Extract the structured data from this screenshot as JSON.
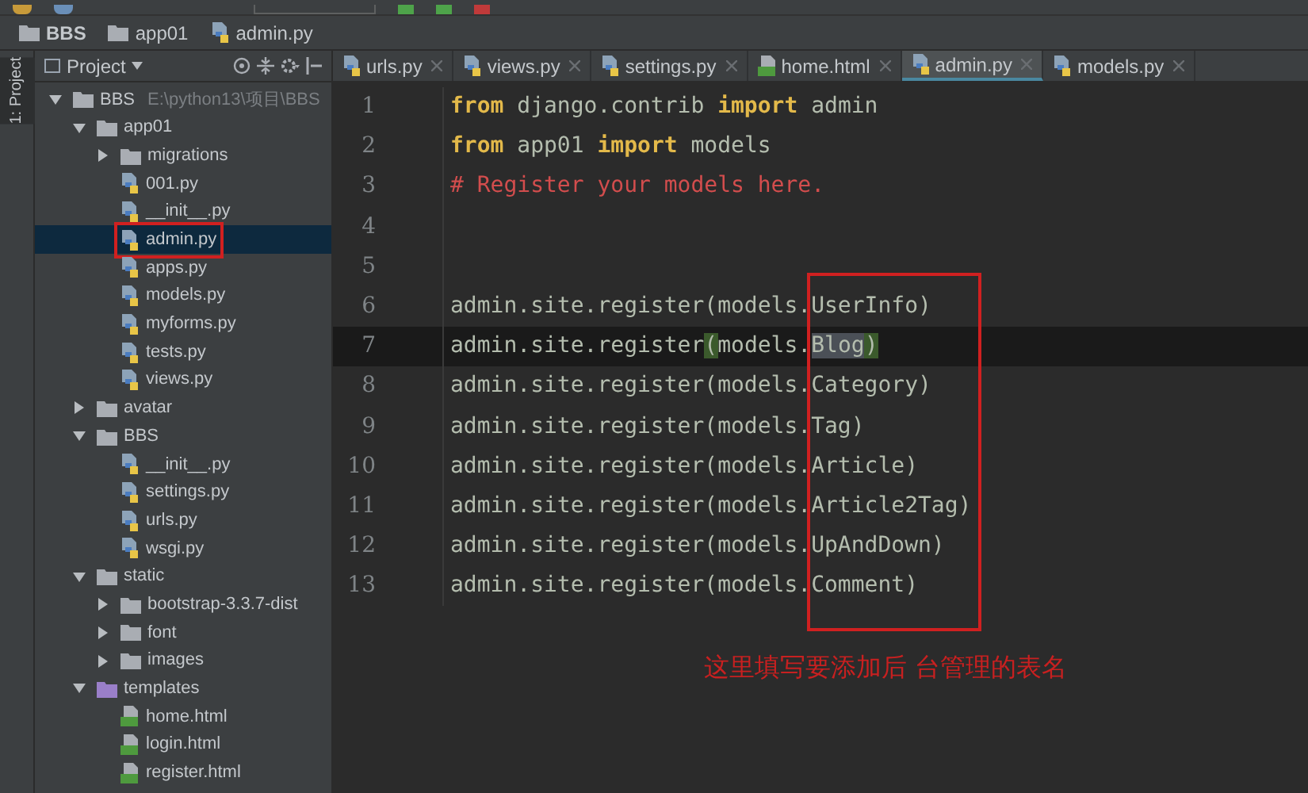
{
  "breadcrumb": [
    {
      "label": "BBS",
      "kind": "folder"
    },
    {
      "label": "app01",
      "kind": "folder"
    },
    {
      "label": "admin.py",
      "kind": "python"
    }
  ],
  "tool_window": {
    "side_label": "1: Project",
    "title": "Project"
  },
  "tree": [
    {
      "label": "BBS",
      "path": "E:\\python13\\项目\\BBS",
      "kind": "folder",
      "expanded": true,
      "selected": false,
      "children": [
        {
          "label": "app01",
          "kind": "folder",
          "expanded": true,
          "selected": false,
          "children": [
            {
              "label": "migrations",
              "kind": "folder",
              "expanded": false,
              "selected": false
            },
            {
              "label": "001.py",
              "kind": "python",
              "selected": false
            },
            {
              "label": "__init__.py",
              "kind": "python",
              "selected": false
            },
            {
              "label": "admin.py",
              "kind": "python",
              "selected": true,
              "boxed": true
            },
            {
              "label": "apps.py",
              "kind": "python",
              "selected": false
            },
            {
              "label": "models.py",
              "kind": "python",
              "selected": false
            },
            {
              "label": "myforms.py",
              "kind": "python",
              "selected": false
            },
            {
              "label": "tests.py",
              "kind": "python",
              "selected": false
            },
            {
              "label": "views.py",
              "kind": "python",
              "selected": false
            }
          ]
        },
        {
          "label": "avatar",
          "kind": "folder",
          "expanded": false,
          "selected": false
        },
        {
          "label": "BBS",
          "kind": "folder",
          "expanded": true,
          "selected": false,
          "children": [
            {
              "label": "__init__.py",
              "kind": "python",
              "selected": false
            },
            {
              "label": "settings.py",
              "kind": "python",
              "selected": false
            },
            {
              "label": "urls.py",
              "kind": "python",
              "selected": false
            },
            {
              "label": "wsgi.py",
              "kind": "python",
              "selected": false
            }
          ]
        },
        {
          "label": "static",
          "kind": "folder",
          "expanded": true,
          "selected": false,
          "children": [
            {
              "label": "bootstrap-3.3.7-dist",
              "kind": "folder",
              "expanded": false,
              "selected": false
            },
            {
              "label": "font",
              "kind": "folder",
              "expanded": false,
              "selected": false
            },
            {
              "label": "images",
              "kind": "folder",
              "expanded": false,
              "selected": false
            }
          ]
        },
        {
          "label": "templates",
          "kind": "template-folder",
          "expanded": true,
          "selected": false,
          "children": [
            {
              "label": "home.html",
              "kind": "html",
              "selected": false
            },
            {
              "label": "login.html",
              "kind": "html",
              "selected": false
            },
            {
              "label": "register.html",
              "kind": "html",
              "selected": false
            }
          ]
        }
      ]
    }
  ],
  "tabs": [
    {
      "label": "urls.py",
      "kind": "python",
      "selected": false
    },
    {
      "label": "views.py",
      "kind": "python",
      "selected": false
    },
    {
      "label": "settings.py",
      "kind": "python",
      "selected": false
    },
    {
      "label": "home.html",
      "kind": "html",
      "selected": false
    },
    {
      "label": "admin.py",
      "kind": "python",
      "selected": true
    },
    {
      "label": "models.py",
      "kind": "python",
      "selected": false
    }
  ],
  "code_lines": [
    {
      "number": "1",
      "current": false,
      "tokens": [
        {
          "kind": "keyword",
          "text": "from"
        },
        {
          "kind": "plain",
          "text": " django.contrib "
        },
        {
          "kind": "keyword",
          "text": "import"
        },
        {
          "kind": "plain",
          "text": " admin"
        }
      ]
    },
    {
      "number": "2",
      "current": false,
      "tokens": [
        {
          "kind": "keyword",
          "text": "from"
        },
        {
          "kind": "plain",
          "text": " app01 "
        },
        {
          "kind": "keyword",
          "text": "import"
        },
        {
          "kind": "plain",
          "text": " models"
        }
      ]
    },
    {
      "number": "3",
      "current": false,
      "tokens": [
        {
          "kind": "comment",
          "text": "# Register your models here."
        }
      ]
    },
    {
      "number": "4",
      "current": false
    },
    {
      "number": "5",
      "current": false
    },
    {
      "number": "6",
      "current": false,
      "tokens": [
        {
          "kind": "plain",
          "text": "admin.site.register(models.UserInfo)"
        }
      ]
    },
    {
      "number": "7",
      "current": true,
      "tokens": [
        {
          "kind": "plain",
          "text": "admin.site.register"
        },
        {
          "kind": "brace-match",
          "text": "("
        },
        {
          "kind": "plain",
          "text": "models."
        },
        {
          "kind": "selected",
          "text": "Blog"
        },
        {
          "kind": "brace-match",
          "text": ")"
        }
      ]
    },
    {
      "number": "8",
      "current": false,
      "tokens": [
        {
          "kind": "plain",
          "text": "admin.site.register(models.Category)"
        }
      ]
    },
    {
      "number": "9",
      "current": false,
      "tokens": [
        {
          "kind": "plain",
          "text": "admin.site.register(models.Tag)"
        }
      ]
    },
    {
      "number": "10",
      "current": false,
      "tokens": [
        {
          "kind": "plain",
          "text": "admin.site.register(models.Article)"
        }
      ]
    },
    {
      "number": "11",
      "current": false,
      "tokens": [
        {
          "kind": "plain",
          "text": "admin.site.register(models.Article2Tag)"
        }
      ]
    },
    {
      "number": "12",
      "current": false,
      "tokens": [
        {
          "kind": "plain",
          "text": "admin.site.register(models.UpAndDown)"
        }
      ]
    },
    {
      "number": "13",
      "current": false,
      "tokens": [
        {
          "kind": "plain",
          "text": "admin.site.register(models.Comment)"
        }
      ]
    }
  ],
  "annotation": {
    "text": "这里填写要添加后 台管理的表名"
  }
}
